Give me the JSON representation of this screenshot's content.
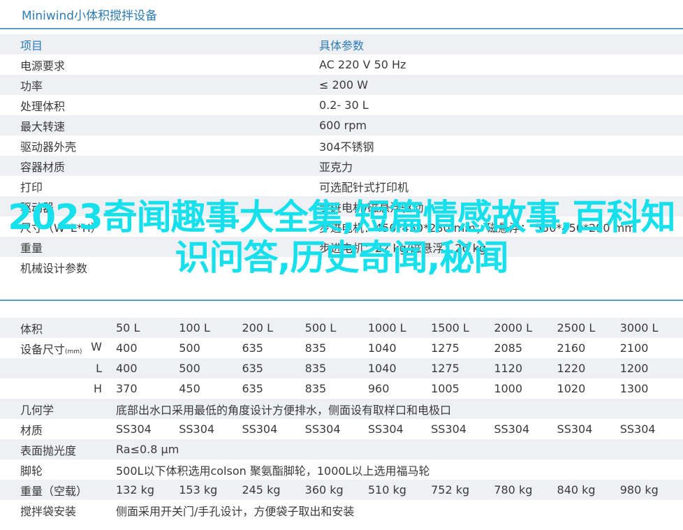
{
  "title": "Miniwind小体积搅拌设备",
  "spec_table": {
    "header": [
      "项目",
      "具体参数"
    ],
    "rows": [
      [
        "电源要求",
        "AC 220 V 50 Hz"
      ],
      [
        "功率",
        "≤ 200 W"
      ],
      [
        "处理体积",
        "0.2- 30 L"
      ],
      [
        "最大转速",
        "600 rpm"
      ],
      [
        "驱动器外壳",
        "304不锈钢"
      ],
      [
        "容器材质",
        "亚克力"
      ],
      [
        "打印",
        "可选配针式打印机"
      ],
      [
        "驱动器",
        "步进电机/磁悬浮驱动"
      ],
      [
        "尺寸（W*L*H）",
        "步进电机：450*450*280 mm；磁悬浮： 550*450*290 mm"
      ],
      [
        "重量",
        "步进电机：22 kg/磁悬浮：26 kg"
      ]
    ]
  },
  "section2_label": "机械设计参数",
  "model_table": {
    "volume_label": "体积",
    "volumes": [
      "50 L",
      "100 L",
      "200 L",
      "500 L",
      "1000 L",
      "1500 L",
      "2000 L",
      "2500 L",
      "3000 L"
    ],
    "size_label": "设备尺寸",
    "size_unit": "(mm)",
    "dims": [
      {
        "axis": "W",
        "values": [
          "400",
          "500",
          "635",
          "835",
          "1040",
          "1275",
          "2085",
          "2160",
          "2100"
        ]
      },
      {
        "axis": "L",
        "values": [
          "400",
          "500",
          "635",
          "835",
          "1040",
          "1275",
          "1120",
          "1220",
          "1200"
        ]
      },
      {
        "axis": "H",
        "values": [
          "370",
          "450",
          "635",
          "835",
          "960",
          "1005",
          "1000",
          "1020",
          "1300"
        ]
      }
    ],
    "geometry_label": "几何学",
    "geometry": "底部出水口采用最低的角度设计方便排水，侧面设有取样口和电极口",
    "material_label": "材质",
    "materials": [
      "SS304",
      "SS304",
      "SS304",
      "SS304",
      "SS304",
      "SS304",
      "SS304",
      "SS304",
      "SS304"
    ],
    "polish_label": "表面抛光度",
    "polish": "Ra≤0.8 μm",
    "wheel_label": "脚轮",
    "wheel": "500L以下体积选用colson 聚氨酯脚轮，1000L以上选用福马轮",
    "weight_label": "重量（空载）",
    "weights": [
      "132 kg",
      "153 kg",
      "245 kg",
      "360 kg",
      "510 kg",
      "752 kg",
      "780 kg",
      "840 kg",
      "980 kg"
    ],
    "bag_label": "搅拌袋安装",
    "bag": "侧面采用开关门/手孔设计，方便袋子取出和安装"
  },
  "overlay_text": "2023奇闻趣事大全集,短篇情感故事,百科知识问答,历史奇闻,秘闻"
}
